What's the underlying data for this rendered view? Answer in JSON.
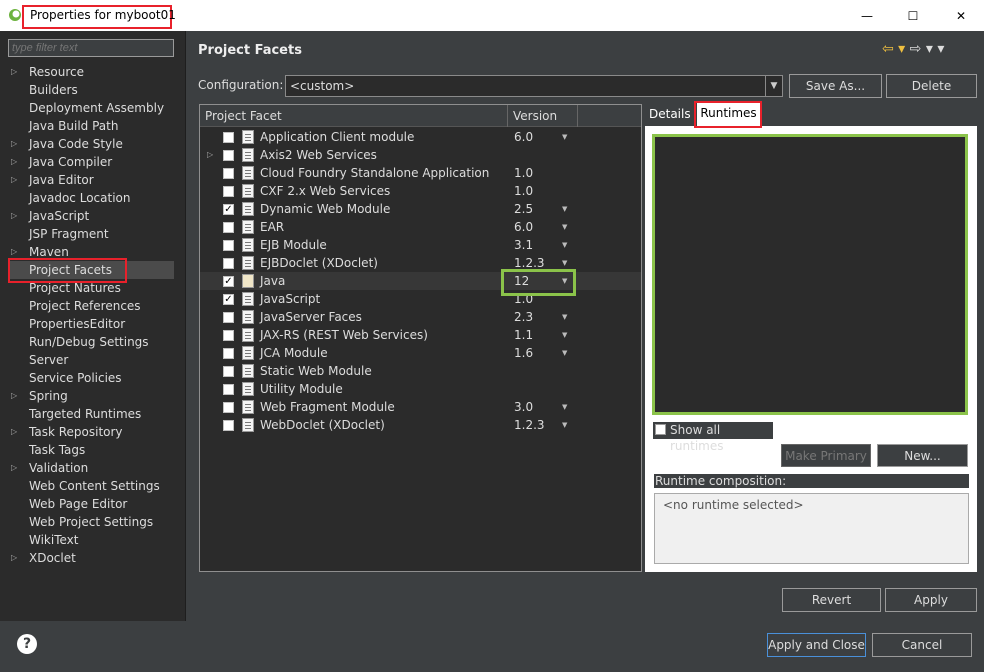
{
  "window": {
    "title": "Properties for myboot01",
    "minimize": "—",
    "maximize": "☐",
    "close": "✕",
    "icon": "eclipse-icon"
  },
  "filter": {
    "placeholder": "type filter text"
  },
  "nav": [
    {
      "label": "Resource",
      "expandable": true
    },
    {
      "label": "Builders",
      "expandable": false
    },
    {
      "label": "Deployment Assembly",
      "expandable": false
    },
    {
      "label": "Java Build Path",
      "expandable": false
    },
    {
      "label": "Java Code Style",
      "expandable": true
    },
    {
      "label": "Java Compiler",
      "expandable": true
    },
    {
      "label": "Java Editor",
      "expandable": true
    },
    {
      "label": "Javadoc Location",
      "expandable": false
    },
    {
      "label": "JavaScript",
      "expandable": true
    },
    {
      "label": "JSP Fragment",
      "expandable": false
    },
    {
      "label": "Maven",
      "expandable": true
    },
    {
      "label": "Project Facets",
      "expandable": false,
      "selected": true
    },
    {
      "label": "Project Natures",
      "expandable": false
    },
    {
      "label": "Project References",
      "expandable": false
    },
    {
      "label": "PropertiesEditor",
      "expandable": false
    },
    {
      "label": "Run/Debug Settings",
      "expandable": false
    },
    {
      "label": "Server",
      "expandable": false
    },
    {
      "label": "Service Policies",
      "expandable": false
    },
    {
      "label": "Spring",
      "expandable": true
    },
    {
      "label": "Targeted Runtimes",
      "expandable": false
    },
    {
      "label": "Task Repository",
      "expandable": true
    },
    {
      "label": "Task Tags",
      "expandable": false
    },
    {
      "label": "Validation",
      "expandable": true
    },
    {
      "label": "Web Content Settings",
      "expandable": false
    },
    {
      "label": "Web Page Editor",
      "expandable": false
    },
    {
      "label": "Web Project Settings",
      "expandable": false
    },
    {
      "label": "WikiText",
      "expandable": false
    },
    {
      "label": "XDoclet",
      "expandable": true
    }
  ],
  "page": {
    "title": "Project Facets",
    "back_icon": "⇦ ▾",
    "forward_icon": "⇨ ▾ ▾"
  },
  "config": {
    "label": "Configuration:",
    "value": "<custom>",
    "save_as": "Save As...",
    "delete": "Delete"
  },
  "facets": {
    "col_facet": "Project Facet",
    "col_version": "Version",
    "rows": [
      {
        "name": "Application Client module",
        "version": "6.0",
        "checked": false,
        "dropdown": true,
        "expandable": false
      },
      {
        "name": "Axis2 Web Services",
        "version": "",
        "checked": false,
        "dropdown": false,
        "expandable": true
      },
      {
        "name": "Cloud Foundry Standalone Application",
        "version": "1.0",
        "checked": false,
        "dropdown": false,
        "expandable": false
      },
      {
        "name": "CXF 2.x Web Services",
        "version": "1.0",
        "checked": false,
        "dropdown": false,
        "expandable": false
      },
      {
        "name": "Dynamic Web Module",
        "version": "2.5",
        "checked": true,
        "dropdown": true,
        "expandable": false
      },
      {
        "name": "EAR",
        "version": "6.0",
        "checked": false,
        "dropdown": true,
        "expandable": false
      },
      {
        "name": "EJB Module",
        "version": "3.1",
        "checked": false,
        "dropdown": true,
        "expandable": false
      },
      {
        "name": "EJBDoclet (XDoclet)",
        "version": "1.2.3",
        "checked": false,
        "dropdown": true,
        "expandable": false
      },
      {
        "name": "Java",
        "version": "12",
        "checked": true,
        "dropdown": true,
        "expandable": false,
        "selected": true
      },
      {
        "name": "JavaScript",
        "version": "1.0",
        "checked": true,
        "dropdown": false,
        "expandable": false
      },
      {
        "name": "JavaServer Faces",
        "version": "2.3",
        "checked": false,
        "dropdown": true,
        "expandable": false
      },
      {
        "name": "JAX-RS (REST Web Services)",
        "version": "1.1",
        "checked": false,
        "dropdown": true,
        "expandable": false
      },
      {
        "name": "JCA Module",
        "version": "1.6",
        "checked": false,
        "dropdown": true,
        "expandable": false
      },
      {
        "name": "Static Web Module",
        "version": "",
        "checked": false,
        "dropdown": false,
        "expandable": false
      },
      {
        "name": "Utility Module",
        "version": "",
        "checked": false,
        "dropdown": false,
        "expandable": false
      },
      {
        "name": "Web Fragment Module",
        "version": "3.0",
        "checked": false,
        "dropdown": true,
        "expandable": false
      },
      {
        "name": "WebDoclet (XDoclet)",
        "version": "1.2.3",
        "checked": false,
        "dropdown": true,
        "expandable": false
      }
    ]
  },
  "tabs": {
    "details": "Details",
    "runtimes": "Runtimes"
  },
  "runtimes": {
    "show_all": "Show all runtimes",
    "make_primary": "Make Primary",
    "new": "New...",
    "composition_label": "Runtime composition:",
    "composition_value": "<no runtime selected>"
  },
  "actions": {
    "revert": "Revert",
    "apply": "Apply",
    "apply_close": "Apply and Close",
    "cancel": "Cancel",
    "help": "?"
  },
  "colors": {
    "highlight_red": "#e8212b",
    "highlight_green": "#8bc34a",
    "background": "#3c3f41"
  }
}
